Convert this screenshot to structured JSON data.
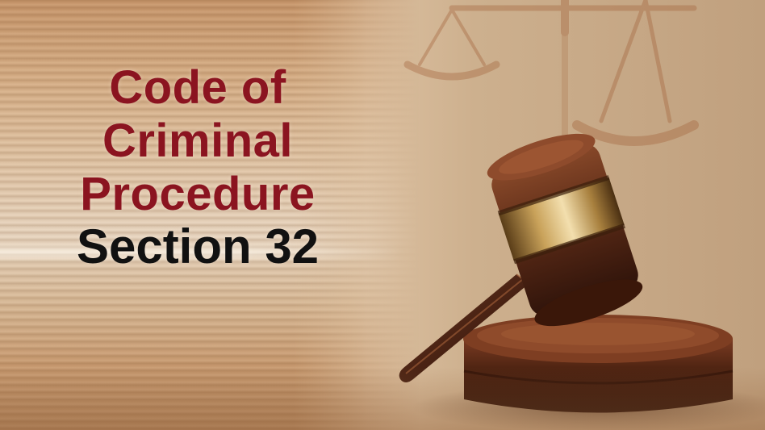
{
  "title": {
    "lines": [
      "Code of",
      "Criminal",
      "Procedure"
    ],
    "section": "Section 32",
    "title_color": "#8b1420",
    "section_color": "#111111"
  },
  "illustration": {
    "icons": [
      "scales-of-justice-icon",
      "gavel-icon",
      "sound-block-icon"
    ]
  }
}
